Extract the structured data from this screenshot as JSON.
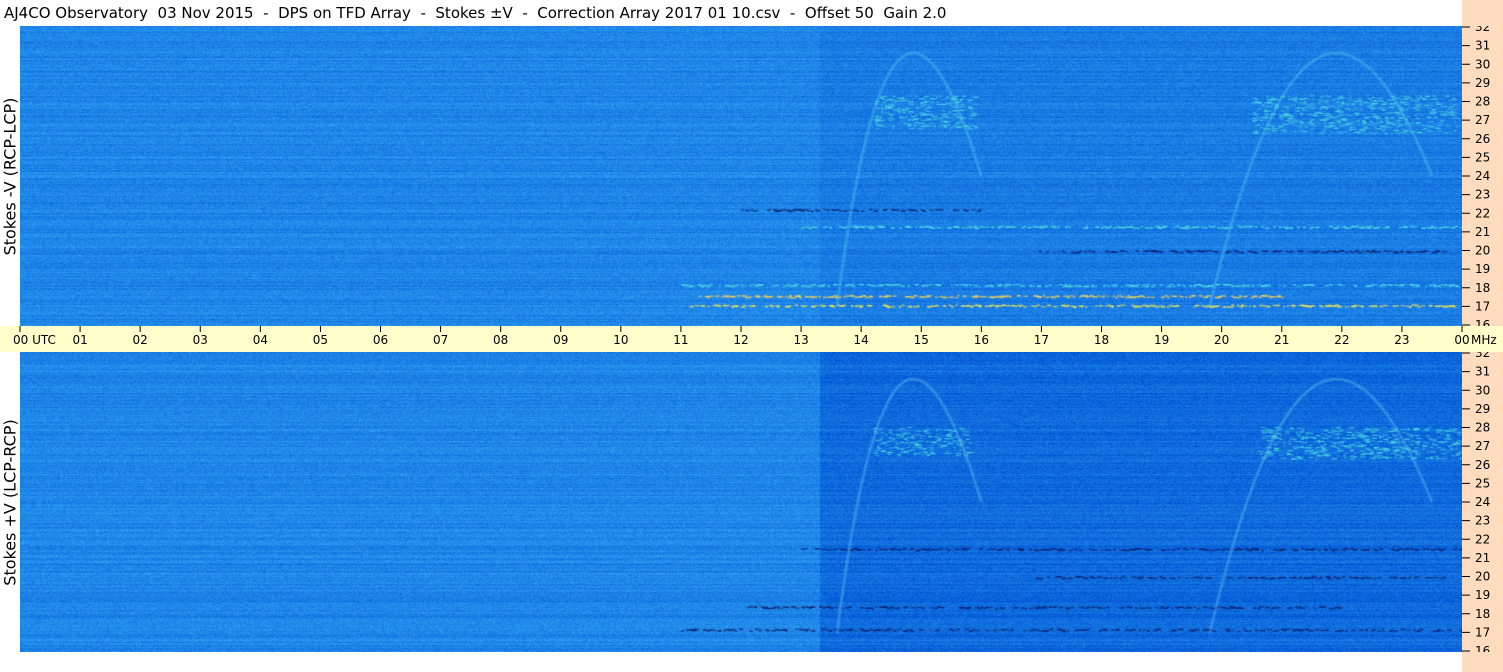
{
  "header": {
    "title": "AJ4CO Observatory  03 Nov 2015  -  DPS on TFD Array  -  Stokes ±V  -  Correction Array 2017 01 10.csv  -  Offset 50  Gain 2.0"
  },
  "colors": {
    "background": "#1f86e8",
    "time_axis_bg": "#ffffcc",
    "freq_axis_bg": "#ffdcbd",
    "emission_cyan": "#4fe0e0",
    "emission_yellow": "#f2e64a",
    "absorption_dark": "#0a1f6e"
  },
  "chart_data": [
    {
      "type": "heatmap",
      "panel": "top",
      "ylabel": "Stokes -V  (RCP-LCP)",
      "x_ticks": [
        "01",
        "02",
        "03",
        "04",
        "05",
        "06",
        "07",
        "08",
        "09",
        "10",
        "11",
        "12",
        "13",
        "14",
        "15",
        "16",
        "17",
        "18",
        "19",
        "20",
        "21",
        "22",
        "23"
      ],
      "x_start_label": "00  UTC",
      "x_end_label": "00",
      "x_unit": "MHz",
      "xlim": [
        0,
        24
      ],
      "y_ticks": [
        "16",
        "17",
        "18",
        "19",
        "20",
        "21",
        "22",
        "23",
        "24",
        "25",
        "26",
        "27",
        "28",
        "29",
        "30",
        "31",
        "32"
      ],
      "ylim": [
        16,
        32
      ],
      "features": [
        {
          "kind": "band",
          "x_range": [
            11,
            23.9
          ],
          "y": 17.1,
          "color": "#f2e64a"
        },
        {
          "kind": "band",
          "x_range": [
            11.3,
            21
          ],
          "y": 17.6,
          "color": "#ffd34a"
        },
        {
          "kind": "band",
          "x_range": [
            11,
            24
          ],
          "y": 18.2,
          "color": "#4fe0e0"
        },
        {
          "kind": "band",
          "x_range": [
            13,
            24
          ],
          "y": 21.3,
          "color": "#4fe0e0"
        },
        {
          "kind": "band",
          "x_range": [
            12,
            16
          ],
          "y": 22.2,
          "color": "#0a1f6e"
        },
        {
          "kind": "band",
          "x_range": [
            16.9,
            23.7
          ],
          "y": 20.0,
          "color": "#0a1f6e"
        },
        {
          "kind": "emission",
          "x_range": [
            14.2,
            15.9
          ],
          "y_range": [
            26.5,
            28.3
          ],
          "color": "#4fe0e0"
        },
        {
          "kind": "emission",
          "x_range": [
            20.5,
            23.9
          ],
          "y_range": [
            26.3,
            28.3
          ],
          "color": "#4fe0e0"
        }
      ]
    },
    {
      "type": "heatmap",
      "panel": "bottom",
      "ylabel": "Stokes +V  (LCP-RCP)",
      "y_ticks": [
        "16",
        "17",
        "18",
        "19",
        "20",
        "21",
        "22",
        "23",
        "24",
        "25",
        "26",
        "27",
        "28",
        "29",
        "30",
        "31",
        "32"
      ],
      "ylim": [
        16,
        32
      ],
      "xlim": [
        0,
        24
      ],
      "features": [
        {
          "kind": "band",
          "x_range": [
            11,
            24
          ],
          "y": 17.2,
          "color": "#0a1f6e"
        },
        {
          "kind": "band",
          "x_range": [
            12,
            22
          ],
          "y": 18.4,
          "color": "#0a1f6e"
        },
        {
          "kind": "band",
          "x_range": [
            16.9,
            23.7
          ],
          "y": 20.0,
          "color": "#0a1f6e"
        },
        {
          "kind": "band",
          "x_range": [
            13,
            24
          ],
          "y": 21.5,
          "color": "#0a1f6e"
        },
        {
          "kind": "emission",
          "x_range": [
            14.2,
            15.8
          ],
          "y_range": [
            26.5,
            28.0
          ],
          "color": "#4fe0e0"
        },
        {
          "kind": "emission",
          "x_range": [
            20.6,
            24
          ],
          "y_range": [
            26.3,
            28.0
          ],
          "color": "#4fe0e0"
        }
      ]
    }
  ]
}
